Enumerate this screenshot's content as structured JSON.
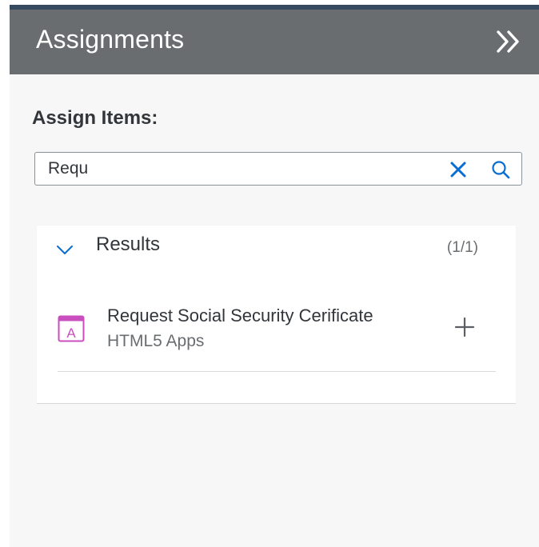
{
  "header": {
    "title": "Assignments",
    "collapse_icon": "double-chevron-right-icon"
  },
  "assign": {
    "label": "Assign Items:"
  },
  "search": {
    "value": "Requ",
    "clear_icon": "close-icon",
    "search_icon": "search-icon"
  },
  "results": {
    "title": "Results",
    "count": "(1/1)",
    "expanded": true,
    "items": [
      {
        "title": "Request Social Security Cerificate",
        "subtitle": "HTML5 Apps",
        "icon": "html5-app-icon",
        "action_icon": "add-icon"
      }
    ]
  },
  "colors": {
    "header_bg": "#6a6d70",
    "top_strip": "#354a5f",
    "panel_bg": "#f7f7f7",
    "accent_blue": "#0a6ed1",
    "app_icon_magenta": "#c94fbf",
    "text_primary": "#32363a",
    "text_secondary": "#6a6d70"
  }
}
